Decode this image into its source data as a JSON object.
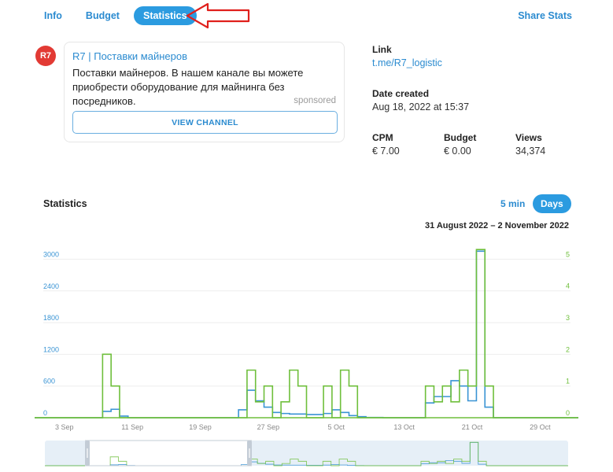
{
  "tabs": [
    {
      "label": "Info",
      "active": false
    },
    {
      "label": "Budget",
      "active": false
    },
    {
      "label": "Statistics",
      "active": true
    }
  ],
  "share_label": "Share Stats",
  "ad": {
    "avatar_text": "R7",
    "title": "R7 | Поставки майнеров",
    "text": "Поставки майнеров. В нашем канале вы можете приобрести оборудование для майнинга без посредников.",
    "sponsored": "sponsored",
    "button": "VIEW CHANNEL"
  },
  "info": {
    "link_label": "Link",
    "link_value": "t.me/R7_logistic",
    "date_label": "Date created",
    "date_value": "Aug 18, 2022 at 15:37",
    "cpm_label": "CPM",
    "cpm_value": "€ 7.00",
    "budget_label": "Budget",
    "budget_value": "€ 0.00",
    "views_label": "Views",
    "views_value": "34,374"
  },
  "stats": {
    "title": "Statistics",
    "zoom_5min": "5 min",
    "zoom_days": "Days",
    "range": "31 August 2022 – 2 November 2022"
  },
  "colors": {
    "accent": "#2b9be0",
    "views_line": "#3a94d4",
    "clicks_line": "#6fbf3c",
    "annotation_arrow": "#e0201c"
  },
  "chart_data": {
    "type": "line",
    "x": [
      "Aug 31",
      "Sep 1",
      "Sep 2",
      "Sep 3",
      "Sep 4",
      "Sep 5",
      "Sep 6",
      "Sep 7",
      "Sep 8",
      "Sep 9",
      "Sep 10",
      "Sep 11",
      "Sep 12",
      "Sep 13",
      "Sep 14",
      "Sep 15",
      "Sep 16",
      "Sep 17",
      "Sep 18",
      "Sep 19",
      "Sep 20",
      "Sep 21",
      "Sep 22",
      "Sep 23",
      "Sep 24",
      "Sep 25",
      "Sep 26",
      "Sep 27",
      "Sep 28",
      "Sep 29",
      "Sep 30",
      "Oct 1",
      "Oct 2",
      "Oct 3",
      "Oct 4",
      "Oct 5",
      "Oct 6",
      "Oct 7",
      "Oct 8",
      "Oct 9",
      "Oct 10",
      "Oct 11",
      "Oct 12",
      "Oct 13",
      "Oct 14",
      "Oct 15",
      "Oct 16",
      "Oct 17",
      "Oct 18",
      "Oct 19",
      "Oct 20",
      "Oct 21",
      "Oct 22",
      "Oct 23",
      "Oct 24",
      "Oct 25",
      "Oct 26",
      "Oct 27",
      "Oct 28",
      "Oct 29",
      "Oct 30",
      "Oct 31",
      "Nov 1",
      "Nov 2"
    ],
    "x_ticks": [
      "3 Sep",
      "11 Sep",
      "19 Sep",
      "27 Sep",
      "5 Oct",
      "13 Oct",
      "21 Oct",
      "29 Oct"
    ],
    "series": [
      {
        "axis": "left",
        "values": [
          0,
          0,
          0,
          0,
          0,
          0,
          0,
          0,
          120,
          160,
          30,
          0,
          0,
          0,
          0,
          0,
          0,
          0,
          0,
          0,
          0,
          0,
          0,
          0,
          150,
          520,
          320,
          200,
          100,
          80,
          70,
          70,
          60,
          60,
          80,
          150,
          100,
          40,
          20,
          5,
          5,
          0,
          0,
          0,
          0,
          0,
          280,
          400,
          400,
          700,
          600,
          320,
          3150,
          200,
          0,
          0,
          0,
          0,
          0,
          0,
          0,
          0,
          0,
          0
        ]
      },
      {
        "axis": "right",
        "values": [
          0,
          0,
          0,
          0,
          0,
          0,
          0,
          0,
          2,
          1,
          0,
          0,
          0,
          0,
          0,
          0,
          0,
          0,
          0,
          0,
          0,
          0,
          0,
          0,
          0,
          1.5,
          0.5,
          1,
          0,
          0.5,
          1.5,
          1,
          0,
          0,
          1,
          0,
          1.5,
          1,
          0,
          0,
          0,
          0,
          0,
          0,
          0,
          0,
          1,
          0.5,
          1,
          0.5,
          1.5,
          1,
          5.3,
          1,
          0,
          0,
          0,
          0,
          0,
          0,
          0,
          0,
          0,
          0
        ]
      }
    ],
    "y_left": {
      "ticks": [
        0,
        600,
        1200,
        1800,
        2400,
        3000
      ],
      "lim": [
        0,
        3200
      ]
    },
    "y_right": {
      "ticks": [
        0,
        1,
        2,
        3,
        4,
        5
      ],
      "lim": [
        0,
        5.33
      ]
    },
    "grid": true,
    "legend": "none"
  }
}
